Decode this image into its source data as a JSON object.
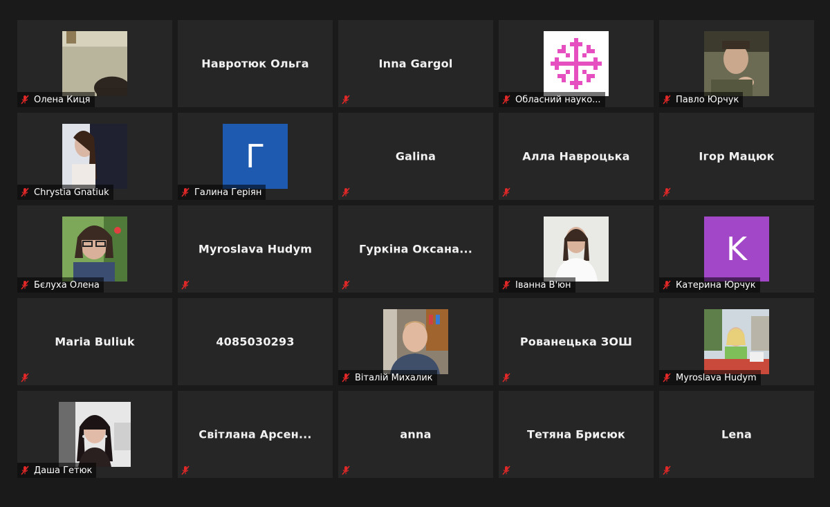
{
  "colors": {
    "background": "#1a1a1a",
    "tile": "#262626",
    "muted_mic": "#e02828",
    "avatar_blue": "#1e5bb0",
    "avatar_purple": "#a347c9",
    "ornament_pink": "#e64fbf"
  },
  "icons": {
    "mic": "microphone-muted-icon"
  },
  "participants": [
    {
      "name": "Олена Киця",
      "display": "photo",
      "label": "Олена Киця"
    },
    {
      "name": "Навротюк Ольга",
      "display": "name"
    },
    {
      "name": "Inna Gargol",
      "display": "name"
    },
    {
      "name": "Обласний науко...",
      "display": "ornament",
      "label": "Обласний науко..."
    },
    {
      "name": "Павло Юрчук",
      "display": "photo",
      "label": "Павло Юрчук"
    },
    {
      "name": "Chrystia Gnatiuk",
      "display": "photo",
      "label": "Chrystia Gnatiuk"
    },
    {
      "name": "Галина Геріян",
      "display": "avatar",
      "avatar_letter": "Г",
      "label": "Галина Геріян"
    },
    {
      "name": "Galina",
      "display": "name"
    },
    {
      "name": "Алла Навроцька",
      "display": "name"
    },
    {
      "name": "Ігор Мацюк",
      "display": "name"
    },
    {
      "name": "Бєлуха Олена",
      "display": "photo",
      "label": "Бєлуха Олена"
    },
    {
      "name": "Myroslava Hudym",
      "display": "name"
    },
    {
      "name": "Гуркіна  Оксана...",
      "display": "name"
    },
    {
      "name": "Іванна В'юн",
      "display": "photo",
      "label": "Іванна В'юн"
    },
    {
      "name": "Катерина Юрчук",
      "display": "avatar",
      "avatar_letter": "K",
      "label": "Катерина Юрчук"
    },
    {
      "name": "Maria Buliuk",
      "display": "name"
    },
    {
      "name": "4085030293",
      "display": "name"
    },
    {
      "name": "Віталій Михалик",
      "display": "photo",
      "label": "Віталій Михалик"
    },
    {
      "name": "Рованецька ЗОШ",
      "display": "name"
    },
    {
      "name": "Myroslava Hudym",
      "display": "photo",
      "label": "Myroslava Hudym"
    },
    {
      "name": "Даша Гетюк",
      "display": "photo",
      "label": "Даша Гетюк"
    },
    {
      "name": "Світлана  Арсен...",
      "display": "name"
    },
    {
      "name": "anna",
      "display": "name"
    },
    {
      "name": "Тетяна Брисюк",
      "display": "name"
    },
    {
      "name": "Lena",
      "display": "name"
    }
  ]
}
